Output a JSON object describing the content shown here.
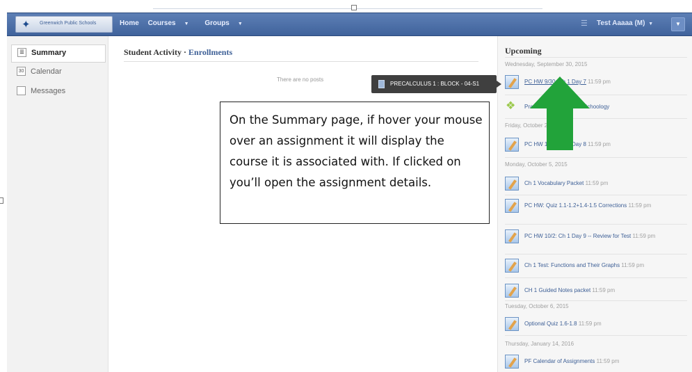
{
  "header": {
    "logo_text": "Greenwich Public Schools",
    "nav": {
      "home": "Home",
      "courses": "Courses",
      "groups": "Groups"
    },
    "user_name": "Test Aaaaa (M)"
  },
  "sidebar": {
    "items": [
      {
        "label": "Summary",
        "icon": "summary-icon",
        "active": true
      },
      {
        "label": "Calendar",
        "icon": "calendar-icon",
        "active": false
      },
      {
        "label": "Messages",
        "icon": "messages-icon",
        "active": false
      }
    ]
  },
  "main": {
    "title": "Student Activity",
    "separator": " · ",
    "tab_enrollments": "Enrollments",
    "empty_text": "There are no posts"
  },
  "tooltip": {
    "text": "PRECALCULUS 1 : BLOCK - 04-S1"
  },
  "upcoming": {
    "title": "Upcoming",
    "dates": [
      "Wednesday, September 30, 2015",
      "Friday, October 2, 2015",
      "Monday, October 5, 2015",
      "Tuesday, October 6, 2015",
      "Thursday, January 14, 2016"
    ],
    "items": [
      {
        "name": "PC HW 9/30: Ch 1 Day 7",
        "time": "11:59 pm"
      },
      {
        "name": "Practice Assessment in Schoology",
        "time": ""
      },
      {
        "name": "PC HW 10/2: Ch 1 Day 8",
        "time": "11:59 pm"
      },
      {
        "name": "Ch 1 Vocabulary Packet",
        "time": "11:59 pm"
      },
      {
        "name": "PC HW: Quiz 1.1-1.2+1.4-1.5 Corrections",
        "time": "11:59 pm"
      },
      {
        "name": "PC HW 10/2: Ch 1 Day 9 -- Review for Test",
        "time": "11:59 pm"
      },
      {
        "name": "Ch 1 Test: Functions and Their Graphs",
        "time": "11:59 pm"
      },
      {
        "name": "CH 1 Guided Notes packet",
        "time": "11:59 pm"
      },
      {
        "name": "Optional Quiz 1.6-1.8",
        "time": "11:59 pm"
      },
      {
        "name": "PF Calendar of Assignments",
        "time": "11:59 pm"
      }
    ]
  },
  "callout": {
    "text": "On the Summary page, if hover your mouse over an assignment it will display the course it is associated with. If clicked on you’ll open the assignment details."
  },
  "colors": {
    "nav_bar": "#4a6ca5",
    "link": "#3d5f96",
    "arrow": "#22a33a",
    "tooltip_bg": "#3f3f3f"
  }
}
